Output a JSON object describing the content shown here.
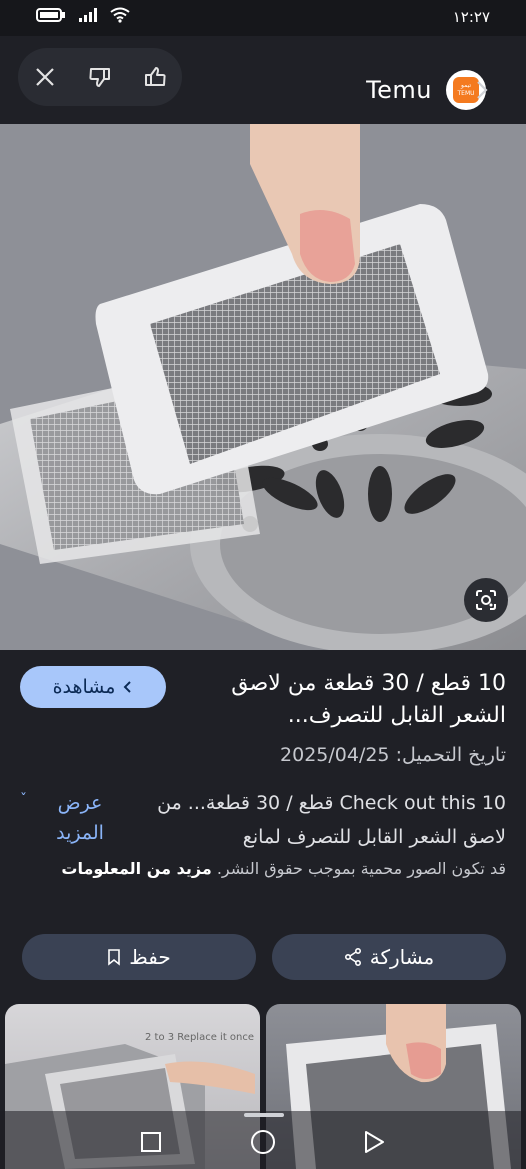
{
  "status": {
    "time": "١٢:٢٧"
  },
  "brand": {
    "name": "Temu",
    "logo_text": "تيمو TEMU"
  },
  "result": {
    "title": "10 قطع / 30 قطعة من لاصق الشعر القابل للتصرف...",
    "view_button": "مشاهدة",
    "upload_date": "تاريخ التحميل: 2025/04/25",
    "description": "Check out this 10 قطع / 30 قطعة... من لاصق الشعر القابل للتصرف لمانع",
    "show_more": "عرض المزيد",
    "copyright_notice": "قد تكون الصور محمية بموجب حقوق النشر.",
    "more_info": "مزيد من المعلومات",
    "share_label": "مشاركة",
    "save_label": "حفظ"
  },
  "thumbs": {
    "caption": "2 to 3 Replace it once"
  },
  "icons": {
    "close": "close-icon",
    "dislike": "thumbs-down-icon",
    "like": "thumbs-up-icon",
    "lens": "lens-icon",
    "share": "share-icon",
    "bookmark": "bookmark-icon"
  },
  "colors": {
    "accent": "#a8c7fa",
    "link": "#8ab4f8",
    "background": "#1f2026",
    "brand": "#f47a1f"
  }
}
